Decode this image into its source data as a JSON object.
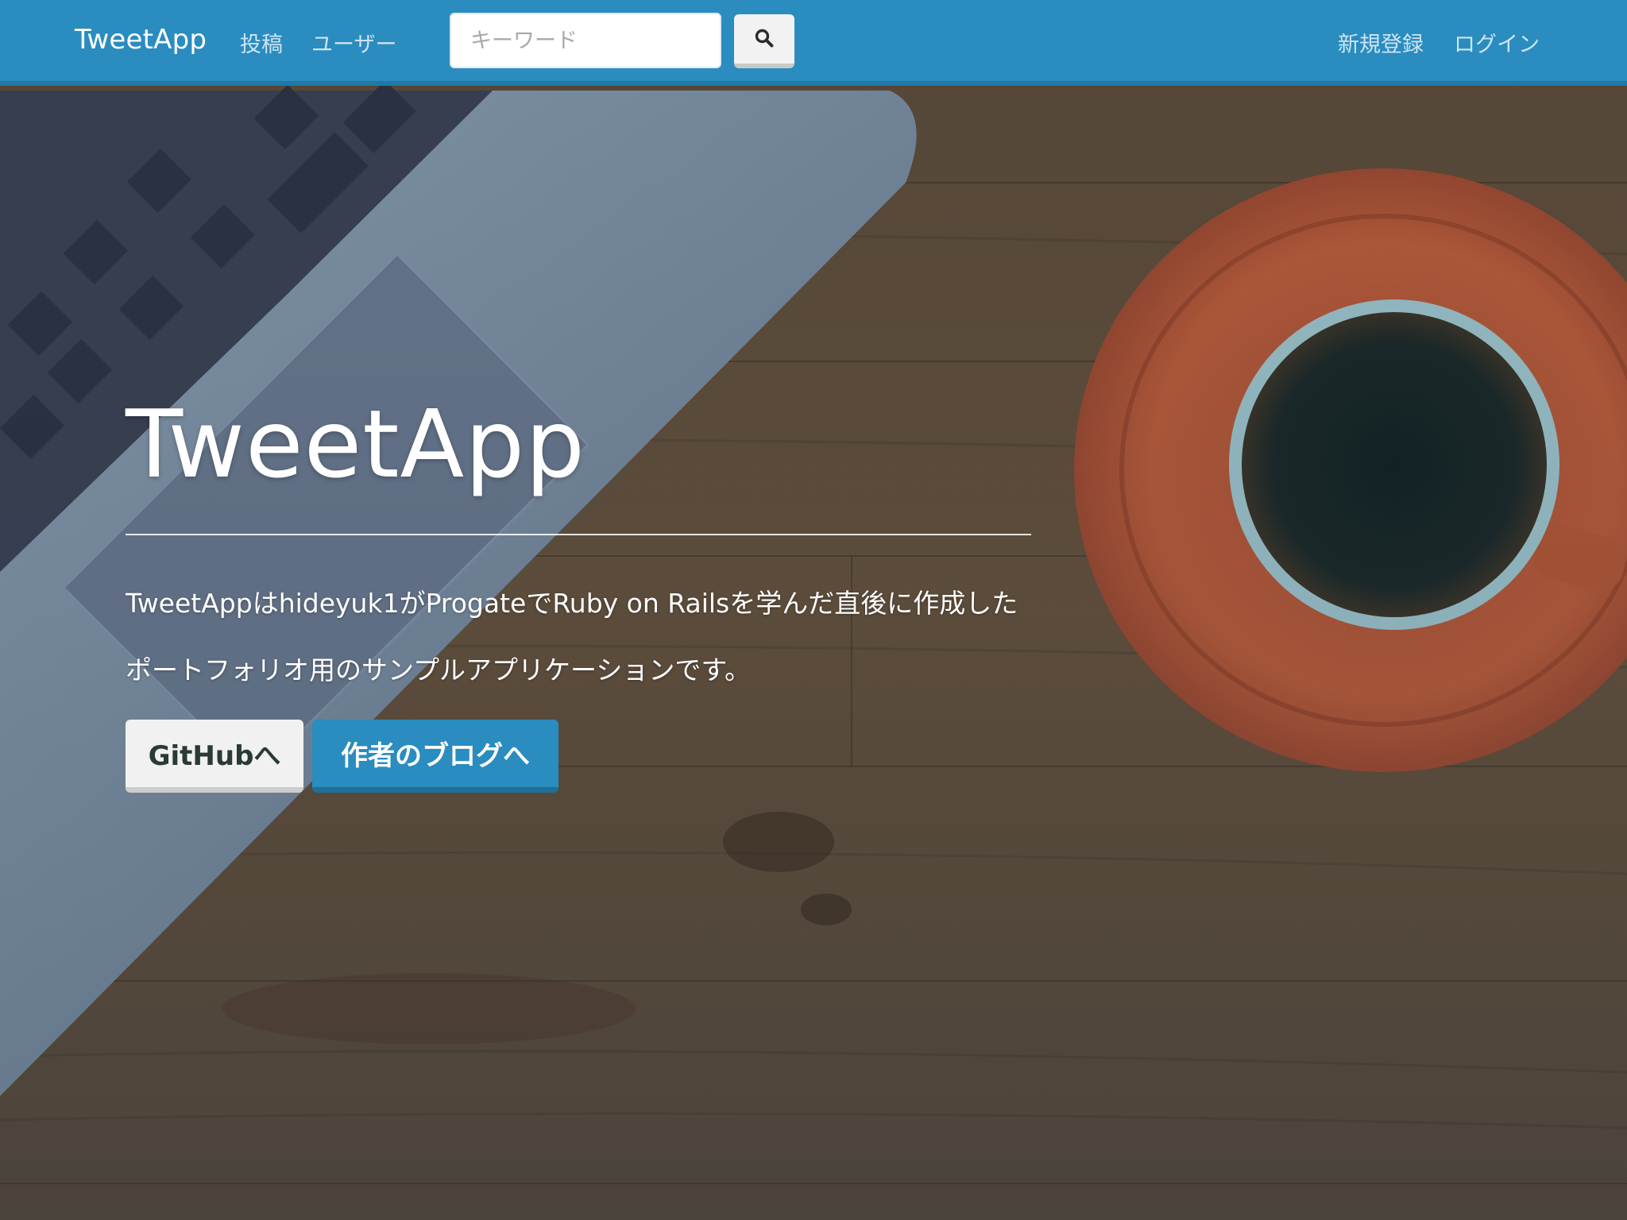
{
  "navbar": {
    "brand": "TweetApp",
    "links": [
      {
        "label": "投稿"
      },
      {
        "label": "ユーザー"
      }
    ],
    "search": {
      "placeholder": "キーワード",
      "value": ""
    },
    "search_button_icon": "search-icon",
    "right_links": [
      {
        "label": "新規登録"
      },
      {
        "label": "ログイン"
      }
    ]
  },
  "hero": {
    "title": "TweetApp",
    "description_line1": "TweetAppはhideyuk1がProgateでRuby on Railsを学んだ直後に作成した",
    "description_line2": "ポートフォリオ用のサンプルアプリケーションです。",
    "buttons": {
      "github": "GitHubへ",
      "blog": "作者のブログへ"
    }
  },
  "colors": {
    "navbar": "#2a8cbf",
    "accent": "#2a8cbf",
    "button_light": "#f1f1f1"
  }
}
